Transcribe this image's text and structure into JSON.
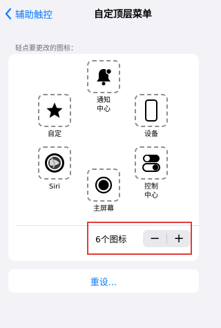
{
  "nav": {
    "back_label": "辅助触控",
    "title": "自定顶层菜单"
  },
  "section_header": "轻点要更改的图标：",
  "slots": [
    {
      "label_lines": [
        "通知",
        "中心"
      ],
      "icon": "bell-icon"
    },
    {
      "label_lines": [
        "自定"
      ],
      "icon": "star-icon"
    },
    {
      "label_lines": [
        "设备"
      ],
      "icon": "iphone-icon"
    },
    {
      "label_lines": [
        "Siri"
      ],
      "icon": "siri-icon"
    },
    {
      "label_lines": [
        "控制",
        "中心"
      ],
      "icon": "toggles-icon"
    },
    {
      "label_lines": [
        "主屏幕"
      ],
      "icon": "home-button-icon"
    }
  ],
  "icon_count_text": "6个图标",
  "stepper": {
    "minus": "−",
    "plus": "+"
  },
  "reset_label": "重设...",
  "colors": {
    "accent": "#0a7aff",
    "highlight": "#e53935",
    "background": "#f2f2f7"
  }
}
